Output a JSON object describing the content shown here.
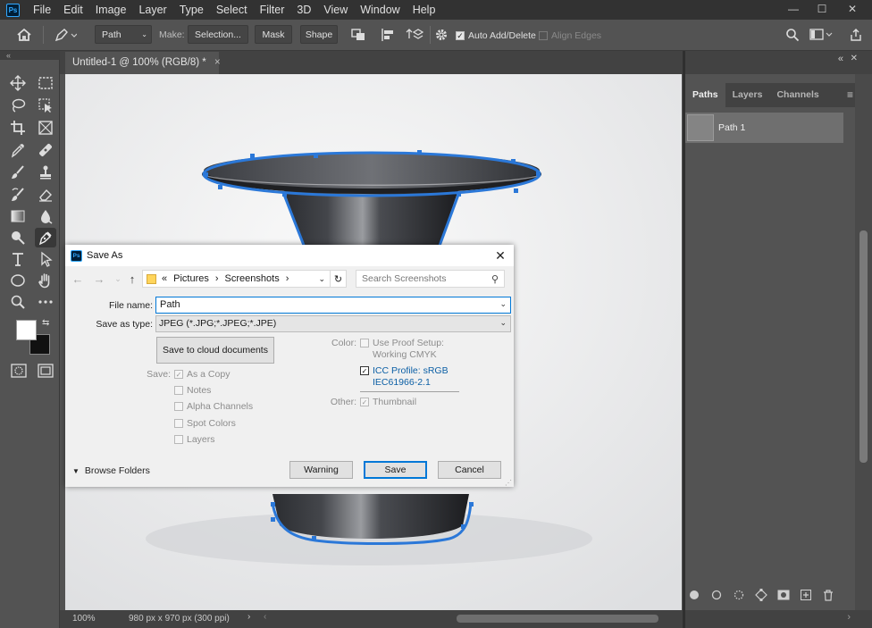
{
  "app": {
    "logo": "Ps"
  },
  "menu": [
    "File",
    "Edit",
    "Image",
    "Layer",
    "Type",
    "Select",
    "Filter",
    "3D",
    "View",
    "Window",
    "Help"
  ],
  "options_bar": {
    "tool_mode": "Path",
    "make_label": "Make:",
    "selection_btn": "Selection...",
    "mask_btn": "Mask",
    "shape_btn": "Shape",
    "auto_add_delete": "Auto Add/Delete",
    "align_edges": "Align Edges"
  },
  "document": {
    "tab_title": "Untitled-1 @ 100% (RGB/8) *",
    "zoom": "100%",
    "doc_info": "980 px x 970 px (300 ppi)"
  },
  "panels": {
    "tabs": [
      "Paths",
      "Layers",
      "Channels"
    ],
    "active_tab": "Paths",
    "paths": [
      {
        "name": "Path 1"
      }
    ]
  },
  "dialog": {
    "title": "Save As",
    "breadcrumb": [
      "Pictures",
      "Screenshots"
    ],
    "breadcrumb_prefix": "«",
    "search_placeholder": "Search Screenshots",
    "file_name_label": "File name:",
    "file_name_value": "Path",
    "save_as_type_label": "Save as type:",
    "save_as_type_value": "JPEG (*.JPG;*.JPEG;*.JPE)",
    "cloud_button": "Save to cloud documents",
    "save_label": "Save:",
    "save_options": [
      {
        "label": "As a Copy",
        "checked": true
      },
      {
        "label": "Notes",
        "checked": false
      },
      {
        "label": "Alpha Channels",
        "checked": false
      },
      {
        "label": "Spot Colors",
        "checked": false
      },
      {
        "label": "Layers",
        "checked": false
      }
    ],
    "color_label": "Color:",
    "use_proof_setup": "Use Proof Setup:",
    "working_cmyk": "Working CMYK",
    "icc_profile": "ICC Profile:  sRGB",
    "icc_profile_2": "IEC61966-2.1",
    "other_label": "Other:",
    "thumbnail": "Thumbnail",
    "browse_folders": "Browse Folders",
    "warning_button": "Warning",
    "save_button": "Save",
    "cancel_button": "Cancel"
  }
}
